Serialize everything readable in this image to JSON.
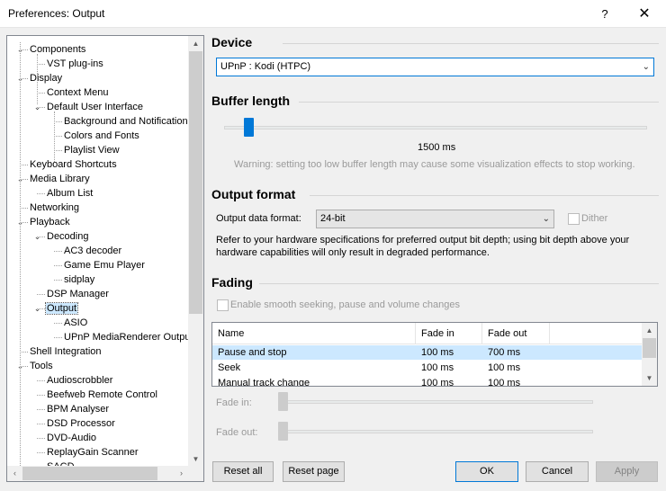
{
  "window": {
    "title": "Preferences: Output",
    "help_glyph": "?",
    "close_glyph": "✕"
  },
  "tree": {
    "items": [
      {
        "label": "Components",
        "level": 0,
        "expanded": true
      },
      {
        "label": "VST plug-ins",
        "level": 1
      },
      {
        "label": "Display",
        "level": 0,
        "expanded": true
      },
      {
        "label": "Context Menu",
        "level": 1
      },
      {
        "label": "Default User Interface",
        "level": 1,
        "expanded": true
      },
      {
        "label": "Background and Notifications",
        "level": 2
      },
      {
        "label": "Colors and Fonts",
        "level": 2
      },
      {
        "label": "Playlist View",
        "level": 2
      },
      {
        "label": "Keyboard Shortcuts",
        "level": 0
      },
      {
        "label": "Media Library",
        "level": 0,
        "expanded": true
      },
      {
        "label": "Album List",
        "level": 1
      },
      {
        "label": "Networking",
        "level": 0
      },
      {
        "label": "Playback",
        "level": 0,
        "expanded": true
      },
      {
        "label": "Decoding",
        "level": 1,
        "expanded": true
      },
      {
        "label": "AC3 decoder",
        "level": 2
      },
      {
        "label": "Game Emu Player",
        "level": 2
      },
      {
        "label": "sidplay",
        "level": 2
      },
      {
        "label": "DSP Manager",
        "level": 1
      },
      {
        "label": "Output",
        "level": 1,
        "expanded": true,
        "selected": true
      },
      {
        "label": "ASIO",
        "level": 2
      },
      {
        "label": "UPnP MediaRenderer Output",
        "level": 2
      },
      {
        "label": "Shell Integration",
        "level": 0
      },
      {
        "label": "Tools",
        "level": 0,
        "expanded": true
      },
      {
        "label": "Audioscrobbler",
        "level": 1
      },
      {
        "label": "Beefweb Remote Control",
        "level": 1
      },
      {
        "label": "BPM Analyser",
        "level": 1
      },
      {
        "label": "DSD Processor",
        "level": 1
      },
      {
        "label": "DVD-Audio",
        "level": 1
      },
      {
        "label": "ReplayGain Scanner",
        "level": 1
      },
      {
        "label": "SACD",
        "level": 1
      }
    ]
  },
  "device": {
    "heading": "Device",
    "selected": "UPnP : Kodi (HTPC)"
  },
  "buffer": {
    "heading": "Buffer length",
    "value_label": "1500 ms",
    "level_fraction": 0.057,
    "warning": "Warning: setting too low buffer length may cause some visualization effects to stop working."
  },
  "output_format": {
    "heading": "Output format",
    "label": "Output data format:",
    "selected": "24-bit",
    "dither_label": "Dither",
    "dither_checked": false,
    "note": "Refer to your hardware specifications for preferred output bit depth; using bit depth above your hardware capabilities will only result in degraded performance."
  },
  "fading": {
    "heading": "Fading",
    "enable_label": "Enable smooth seeking, pause and volume changes",
    "enable_checked": false,
    "columns": [
      "Name",
      "Fade in",
      "Fade out"
    ],
    "rows": [
      {
        "name": "Pause and stop",
        "fade_in": "100 ms",
        "fade_out": "700 ms",
        "selected": true
      },
      {
        "name": "Seek",
        "fade_in": "100 ms",
        "fade_out": "100 ms"
      },
      {
        "name": "Manual track change",
        "fade_in": "100 ms",
        "fade_out": "100 ms"
      }
    ],
    "fade_in_label": "Fade in:",
    "fade_out_label": "Fade out:"
  },
  "buttons": {
    "reset_all": "Reset all",
    "reset_page": "Reset page",
    "ok": "OK",
    "cancel": "Cancel",
    "apply": "Apply"
  }
}
